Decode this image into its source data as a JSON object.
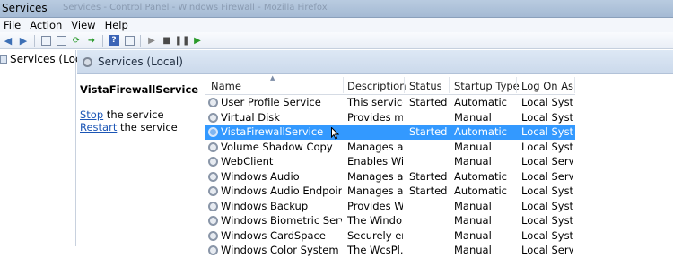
{
  "window": {
    "title": "Services",
    "background_title": "Services - Control Panel - Windows Firewall - Mozilla Firefox"
  },
  "menu": [
    "File",
    "Action",
    "View",
    "Help"
  ],
  "toolbar": {
    "buttons": [
      "back-icon",
      "forward-icon",
      "show-hide-tree-icon",
      "properties-icon",
      "refresh-icon",
      "export-icon",
      "help-icon",
      "start-icon",
      "stop-icon",
      "pause-icon",
      "restart-icon"
    ]
  },
  "tree": {
    "root_label": "Services (Local)"
  },
  "pane": {
    "title": "Services (Local)"
  },
  "description": {
    "service_name": "VistaFirewallService",
    "stop_link": "Stop",
    "stop_suffix": " the service",
    "restart_link": "Restart",
    "restart_suffix": " the service"
  },
  "table": {
    "columns": [
      "Name",
      "Description",
      "Status",
      "Startup Type",
      "Log On As"
    ],
    "rows": [
      {
        "name": "User Profile Service",
        "description": "This service ...",
        "status": "Started",
        "startup": "Automatic",
        "logon": "Local Syst..."
      },
      {
        "name": "Virtual Disk",
        "description": "Provides m...",
        "status": "",
        "startup": "Manual",
        "logon": "Local Syst..."
      },
      {
        "name": "VistaFirewallService",
        "description": "",
        "status": "Started",
        "startup": "Automatic",
        "logon": "Local Syst...",
        "selected": true
      },
      {
        "name": "Volume Shadow Copy",
        "description": "Manages an...",
        "status": "",
        "startup": "Manual",
        "logon": "Local Syst..."
      },
      {
        "name": "WebClient",
        "description": "Enables Wi...",
        "status": "",
        "startup": "Manual",
        "logon": "Local Servi..."
      },
      {
        "name": "Windows Audio",
        "description": "Manages au...",
        "status": "Started",
        "startup": "Automatic",
        "logon": "Local Servi..."
      },
      {
        "name": "Windows Audio Endpoint B...",
        "description": "Manages au...",
        "status": "Started",
        "startup": "Automatic",
        "logon": "Local Syst..."
      },
      {
        "name": "Windows Backup",
        "description": "Provides Wi...",
        "status": "",
        "startup": "Manual",
        "logon": "Local Syst..."
      },
      {
        "name": "Windows Biometric Service",
        "description": "The Windo...",
        "status": "",
        "startup": "Manual",
        "logon": "Local Syst..."
      },
      {
        "name": "Windows CardSpace",
        "description": "Securely en...",
        "status": "",
        "startup": "Manual",
        "logon": "Local Syst..."
      },
      {
        "name": "Windows Color System",
        "description": "The WcsPl...",
        "status": "",
        "startup": "Manual",
        "logon": "Local Servi..."
      }
    ]
  },
  "colors": {
    "selection": "#3399ff",
    "link": "#1b55b5"
  }
}
